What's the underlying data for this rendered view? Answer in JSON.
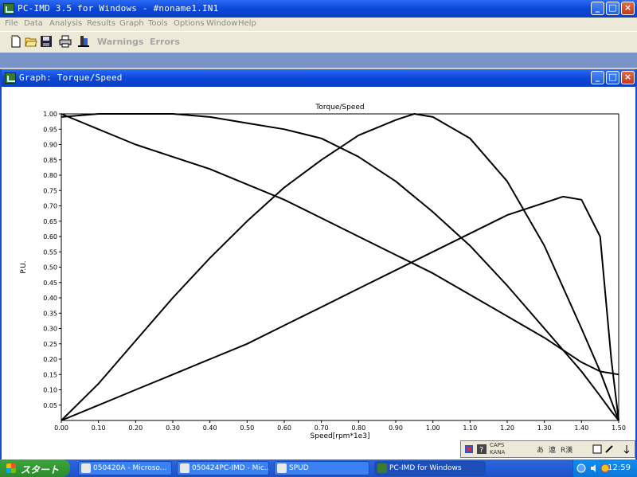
{
  "app": {
    "title": "PC-IMD 3.5 for Windows - #noname1.IN1",
    "menu": [
      "File",
      "Data",
      "Analysis",
      "Results",
      "Graph",
      "Tools",
      "Options",
      "Window",
      "Help"
    ],
    "toolbar": {
      "warnings": "Warnings",
      "errors": "Errors"
    }
  },
  "graph_window": {
    "title": "Graph: Torque/Speed"
  },
  "chart_data": {
    "type": "line",
    "title": "Torque/Speed",
    "xlabel": "Speed[rpm*1e3]",
    "ylabel": "P.U.",
    "xlim": [
      0,
      1.5
    ],
    "ylim": [
      0,
      1.0
    ],
    "x_ticks": [
      "0.00",
      "0.10",
      "0.20",
      "0.30",
      "0.40",
      "0.50",
      "0.60",
      "0.70",
      "0.80",
      "0.90",
      "1.00",
      "1.10",
      "1.20",
      "1.30",
      "1.40",
      "1.50"
    ],
    "y_ticks": [
      "0.05",
      "0.10",
      "0.15",
      "0.20",
      "0.25",
      "0.30",
      "0.35",
      "0.40",
      "0.45",
      "0.50",
      "0.55",
      "0.60",
      "0.65",
      "0.70",
      "0.75",
      "0.80",
      "0.85",
      "0.90",
      "0.95",
      "1.00"
    ],
    "series": [
      {
        "x": [
          0,
          0.1,
          0.2,
          0.3,
          0.4,
          0.5,
          0.6,
          0.7,
          0.8,
          0.9,
          1.0,
          1.1,
          1.2,
          1.3,
          1.4,
          1.45,
          1.5
        ],
        "values": [
          1.0,
          0.95,
          0.9,
          0.86,
          0.82,
          0.77,
          0.72,
          0.66,
          0.6,
          0.54,
          0.48,
          0.41,
          0.34,
          0.27,
          0.19,
          0.16,
          0.15
        ]
      },
      {
        "x": [
          0,
          0.1,
          0.2,
          0.3,
          0.4,
          0.5,
          0.6,
          0.7,
          0.8,
          0.9,
          1.0,
          1.1,
          1.2,
          1.3,
          1.4,
          1.45,
          1.48,
          1.5
        ],
        "values": [
          0.99,
          1.0,
          1.0,
          1.0,
          0.99,
          0.97,
          0.95,
          0.92,
          0.86,
          0.78,
          0.68,
          0.57,
          0.44,
          0.3,
          0.16,
          0.08,
          0.03,
          0.0
        ]
      },
      {
        "x": [
          0,
          0.1,
          0.2,
          0.3,
          0.4,
          0.5,
          0.6,
          0.7,
          0.8,
          0.9,
          0.95,
          1.0,
          1.1,
          1.2,
          1.3,
          1.4,
          1.45,
          1.5
        ],
        "values": [
          0.0,
          0.12,
          0.26,
          0.4,
          0.53,
          0.65,
          0.76,
          0.85,
          0.93,
          0.98,
          1.0,
          0.99,
          0.92,
          0.78,
          0.57,
          0.3,
          0.16,
          0.0
        ]
      },
      {
        "x": [
          0,
          0.1,
          0.2,
          0.3,
          0.4,
          0.5,
          0.6,
          0.7,
          0.8,
          0.9,
          1.0,
          1.1,
          1.2,
          1.3,
          1.35,
          1.4,
          1.45,
          1.48,
          1.5
        ],
        "values": [
          0.0,
          0.05,
          0.1,
          0.15,
          0.2,
          0.25,
          0.31,
          0.37,
          0.43,
          0.49,
          0.55,
          0.61,
          0.67,
          0.71,
          0.73,
          0.72,
          0.6,
          0.2,
          0.0
        ]
      }
    ]
  },
  "ime": {
    "caps": "CAPS",
    "kana": "KANA",
    "a": "あ",
    "ren": "連",
    "kan": "R漢"
  },
  "taskbar": {
    "start": "スタート",
    "items": [
      "050420A - Microso...",
      "050424PC-IMD - Mic...",
      "SPUD",
      "PC-IMD for Windows"
    ],
    "time": "12:59"
  }
}
